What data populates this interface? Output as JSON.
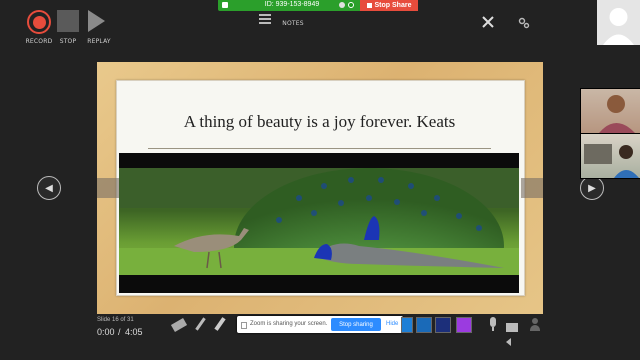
{
  "controls": {
    "record_label": "RECORD",
    "stop_label": "STOP",
    "replay_label": "REPLAY",
    "notes_label": "NOTES"
  },
  "zoom": {
    "meeting_id": "ID: 939-153-8949",
    "stop_share_label": "Stop Share",
    "sharing_message": "Zoom is sharing your screen.",
    "stop_sharing_label": "Stop sharing",
    "hide_label": "Hide"
  },
  "slide": {
    "title": "A thing of beauty is a joy forever. Keats",
    "counter": "Slide 16 of 31",
    "elapsed": "0:00",
    "separator": "/",
    "total": "4:05"
  },
  "ink_colors": [
    "#1e7fd6",
    "#1a6ab8",
    "#1c2f7a",
    "#9b3be0"
  ],
  "icons": {
    "record": "record-icon",
    "stop": "stop-icon",
    "replay": "play-icon",
    "notes": "notes-icon",
    "close": "close-icon",
    "settings": "settings-icon",
    "prev": "chevron-left-icon",
    "next": "chevron-right-icon"
  }
}
